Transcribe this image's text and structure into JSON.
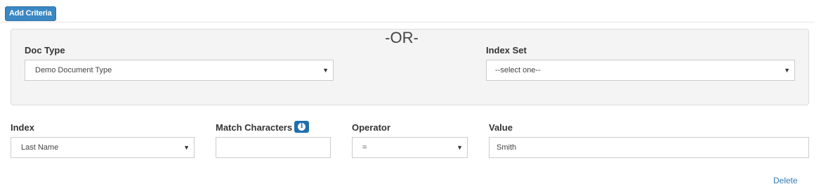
{
  "toolbar": {
    "add_criteria_label": "Add Criteria"
  },
  "doc_panel": {
    "doc_type": {
      "label": "Doc Type",
      "selected": "Demo Document Type"
    },
    "separator": "-OR-",
    "index_set": {
      "label": "Index Set",
      "selected": "--select one--"
    }
  },
  "criteria_row": {
    "index": {
      "label": "Index",
      "selected": "Last Name"
    },
    "match_characters": {
      "label": "Match Characters",
      "value": "",
      "info_icon": "info-circle-icon"
    },
    "operator": {
      "label": "Operator",
      "selected": "="
    },
    "value": {
      "label": "Value",
      "value": "Smith"
    },
    "delete_label": "Delete"
  },
  "colors": {
    "primary_button": "#3a87c3",
    "info_badge": "#1f6fad",
    "link": "#337ab7",
    "panel_bg": "#f4f4f4"
  }
}
